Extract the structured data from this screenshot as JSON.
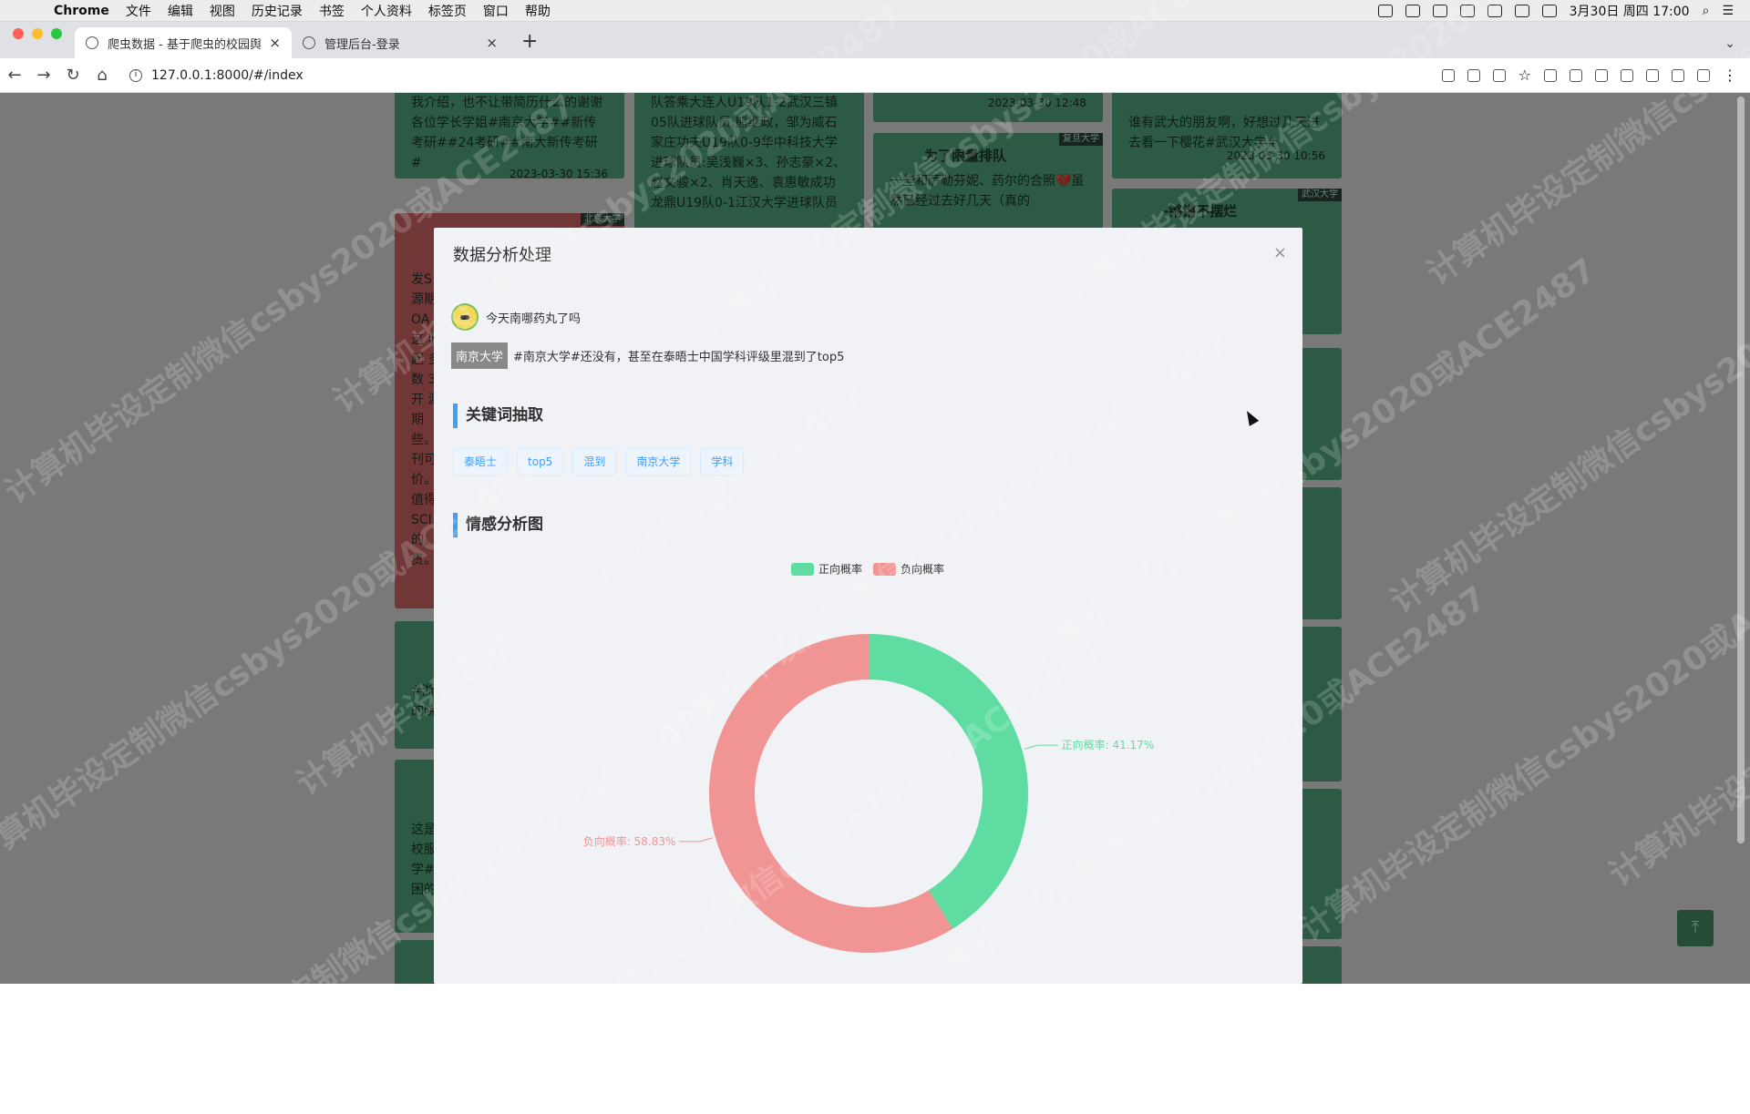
{
  "menubar": {
    "app": "Chrome",
    "items": [
      "文件",
      "编辑",
      "视图",
      "历史记录",
      "书签",
      "个人资料",
      "标签页",
      "窗口",
      "帮助"
    ],
    "datetime": "3月30日 周四 17:00"
  },
  "tabs": [
    {
      "title": "爬虫数据 - 基于爬虫的校园舆情分析",
      "close": "×"
    },
    {
      "title": "管理后台-登录",
      "close": "×"
    }
  ],
  "newtab": "+",
  "address": {
    "url": "127.0.0.1:8000/#/index"
  },
  "cards": [
    {
      "text": "我介绍，也不让带简历什么的谢谢各位学长学姐#南京大学##新传考研##24考研##南大新传考研#",
      "date": "2023-03-30 15:36"
    },
    {
      "text": "队答乘大连人U19队1-2武汉三镇05队进球队员:熊继政，邹为威石家庄功夫U19队0-9华中科技大学进球队员:吴浅巍×3、孙志豪×2、赵文骏×2、肖天逸、袁惠敏成功龙鼎U19队0-1江汉大学进球队员"
    },
    {
      "text": "",
      "date": "2023-03-30 12:48"
    },
    {
      "text": "谁有武大的朋友啊，好想过几天进去看一下樱花#武汉大学#",
      "date": "2023-03-30 10:56"
    },
    {
      "school": "复旦大学",
      "name": "为了限量排队",
      "text": "一些和萨勒芬妮、药尔的合照💔虽然已经过去好几天（真的"
    },
    {
      "school": "武汉大学",
      "name": "-锵锵不摆烂",
      "text": ""
    },
    {
      "school": "北京大学",
      "text": "发S 源期 OA 是这 收起 多数 3.开 源期 些。 刊可 价。 值得 SCI 的。 贵。"
    },
    {
      "text": "#浙 的院"
    },
    {
      "text": "这是 校服 学# 困的"
    }
  ],
  "dialog": {
    "title": "数据分析处理",
    "close": "×",
    "author": "今天南哪药丸了吗",
    "school": "南京大学",
    "content": "#南京大学#还没有，甚至在泰晤士中国学科评级里混到了top5",
    "section_keywords": "关键词抽取",
    "keywords": [
      "泰晤士",
      "top5",
      "混到",
      "南京大学",
      "学科"
    ],
    "section_sentiment": "情感分析图"
  },
  "chart_data": {
    "type": "pie",
    "donut": true,
    "legend_position": "top-center",
    "series": [
      {
        "name": "正向概率",
        "value": 41.17,
        "label": "正向概率: 41.17%",
        "color": "#5fdca2"
      },
      {
        "name": "负向概率",
        "value": 58.83,
        "label": "负向概率: 58.83%",
        "color": "#f19494"
      }
    ]
  },
  "watermark": "计算机毕设定制微信csbys2020或ACE2487",
  "scroll_top_icon": "arrow-up-icon"
}
